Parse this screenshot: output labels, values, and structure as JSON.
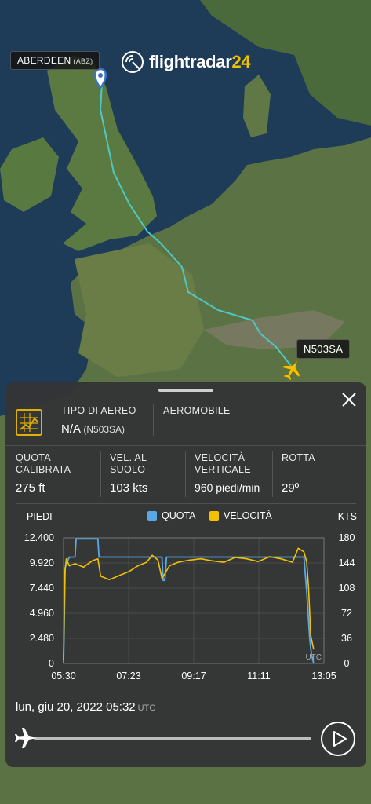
{
  "brand": {
    "name_part1": "flightradar",
    "name_part2": "24"
  },
  "map": {
    "origin_label": "ABERDEEN",
    "origin_code": "(ABZ)",
    "aircraft_label": "N503SA"
  },
  "panel": {
    "aircraft_type_label": "TIPO DI AEREO",
    "aircraft_type_value": "N/A",
    "aircraft_type_reg": "(N503SA)",
    "aircraft_label": "AEROMOBILE",
    "stats": [
      {
        "label": "QUOTA CALIBRATA",
        "value": "275 ft"
      },
      {
        "label": "VEL. AL SUOLO",
        "value": "103 kts"
      },
      {
        "label": "VELOCITÀ VERTICALE",
        "value": "960 piedi/min"
      },
      {
        "label": "ROTTA",
        "value": "29º"
      }
    ],
    "date": "lun, giu 20, 2022",
    "time": "05:32",
    "tz": "UTC"
  },
  "colors": {
    "altitude": "#5aa9e6",
    "speed": "#f2c200",
    "track": "#4ec8c0",
    "accent": "#f2c200"
  },
  "chart_data": {
    "type": "line",
    "legend": [
      "QUOTA",
      "VELOCITÀ"
    ],
    "left_axis_title": "PIEDI",
    "right_axis_title": "KTS",
    "left_ticks": [
      "12.400",
      "9.920",
      "7.440",
      "4.960",
      "2.480",
      "0"
    ],
    "right_ticks": [
      "180",
      "144",
      "108",
      "72",
      "36",
      "0"
    ],
    "x_ticks": [
      "05:30",
      "07:23",
      "09:17",
      "11:11",
      "13:05"
    ],
    "tz_label": "UTC",
    "ylim_left": [
      0,
      12400
    ],
    "ylim_right": [
      0,
      180
    ],
    "xlim_minutes": [
      0,
      455
    ],
    "series": [
      {
        "name": "QUOTA",
        "axis": "left",
        "color": "#5aa9e6",
        "x": [
          0,
          3,
          10,
          20,
          22,
          60,
          62,
          80,
          115,
          172,
          174,
          177,
          180,
          405,
          420,
          425,
          430,
          433,
          437
        ],
        "y": [
          0,
          9500,
          10500,
          10500,
          12300,
          12300,
          10500,
          10500,
          10500,
          10500,
          8200,
          8200,
          10500,
          10500,
          10500,
          7000,
          2500,
          1000,
          0
        ]
      },
      {
        "name": "VELOCITÀ",
        "axis": "right",
        "color": "#f2c200",
        "x": [
          0,
          2,
          5,
          10,
          20,
          35,
          50,
          60,
          65,
          80,
          100,
          115,
          130,
          145,
          155,
          165,
          172,
          178,
          185,
          200,
          220,
          240,
          260,
          280,
          300,
          320,
          340,
          360,
          380,
          400,
          410,
          420,
          425,
          428,
          432,
          437
        ],
        "y": [
          5,
          130,
          150,
          140,
          143,
          138,
          147,
          150,
          125,
          120,
          127,
          132,
          140,
          145,
          155,
          148,
          122,
          130,
          140,
          145,
          148,
          150,
          147,
          145,
          152,
          150,
          146,
          153,
          150,
          145,
          165,
          160,
          145,
          110,
          40,
          20
        ]
      }
    ]
  }
}
